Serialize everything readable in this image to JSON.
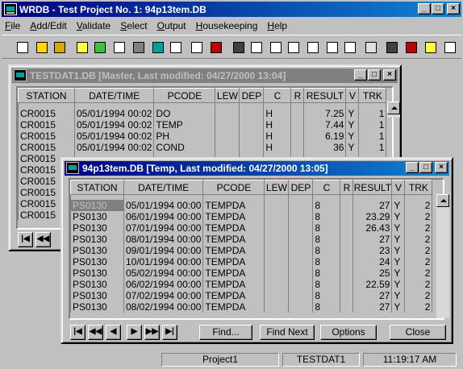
{
  "app": {
    "title": "WRDB - Test Project No. 1: 94p13tem.DB",
    "menu": [
      "File",
      "Add/Edit",
      "Validate",
      "Select",
      "Output",
      "Housekeeping",
      "Help"
    ],
    "window_buttons": {
      "minimize": "_",
      "maximize": "□",
      "close": "×"
    }
  },
  "toolbar_icons": [
    "new-icon",
    "open-icon",
    "open-folder-icon",
    "folder-yellow-icon",
    "folder-green-icon",
    "print-preview-icon",
    "print-icon",
    "calculator-icon",
    "table-icon",
    "stack-icon",
    "db-icon",
    "binoculars-icon",
    "search-doc-icon",
    "grid-icon",
    "copy-icon",
    "spreadsheet-icon",
    "line-chart-icon",
    "line-chart-red-icon",
    "database-icon",
    "save-icon",
    "delete-icon",
    "import-icon",
    "draw-icon"
  ],
  "status": {
    "project": "Project1",
    "table": "TESTDAT1",
    "time": "11:19:17 AM"
  },
  "back_window": {
    "title": "TESTDAT1.DB  [Master,  Last modified: 04/27/2000 13:04]",
    "columns": [
      "STATION",
      "DATE/TIME",
      "PCODE",
      "LEW",
      "DEP",
      "C",
      "R",
      "RESULT",
      "V",
      "TRK"
    ],
    "rows": [
      [
        "CR0015",
        "05/01/1994 00:02",
        "DO",
        "",
        "",
        "H",
        "",
        "7.25",
        "Y",
        "1"
      ],
      [
        "CR0015",
        "05/01/1994 00:02",
        "TEMP",
        "",
        "",
        "H",
        "",
        "7.44",
        "Y",
        "1"
      ],
      [
        "CR0015",
        "05/01/1994 00:02",
        "PH",
        "",
        "",
        "H",
        "",
        "6.19",
        "Y",
        "1"
      ],
      [
        "CR0015",
        "05/01/1994 00:02",
        "COND",
        "",
        "",
        "H",
        "",
        "36",
        "Y",
        "1"
      ],
      [
        "CR0015",
        "",
        "",
        "",
        "",
        "",
        "",
        "",
        "",
        ""
      ],
      [
        "CR0015",
        "",
        "",
        "",
        "",
        "",
        "",
        "",
        "",
        ""
      ],
      [
        "CR0015",
        "",
        "",
        "",
        "",
        "",
        "",
        "",
        "",
        ""
      ],
      [
        "CR0015",
        "",
        "",
        "",
        "",
        "",
        "",
        "",
        "",
        ""
      ],
      [
        "CR0015",
        "",
        "",
        "",
        "",
        "",
        "",
        "",
        "",
        ""
      ],
      [
        "CR0015",
        "",
        "",
        "",
        "",
        "",
        "",
        "",
        "",
        ""
      ]
    ]
  },
  "front_window": {
    "title": "94p13tem.DB  [Temp,  Last modified: 04/27/2000 13:05]",
    "columns": [
      "STATION",
      "DATE/TIME",
      "PCODE",
      "LEW",
      "DEP",
      "C",
      "R",
      "RESULT",
      "V",
      "TRK"
    ],
    "rows": [
      [
        "PS0130",
        "05/01/1994 00:00",
        "TEMPDA",
        "",
        "",
        "8",
        "",
        "27",
        "Y",
        "2"
      ],
      [
        "PS0130",
        "06/01/1994 00:00",
        "TEMPDA",
        "",
        "",
        "8",
        "",
        "23.29",
        "Y",
        "2"
      ],
      [
        "PS0130",
        "07/01/1994 00:00",
        "TEMPDA",
        "",
        "",
        "8",
        "",
        "26.43",
        "Y",
        "2"
      ],
      [
        "PS0130",
        "08/01/1994 00:00",
        "TEMPDA",
        "",
        "",
        "8",
        "",
        "27",
        "Y",
        "2"
      ],
      [
        "PS0130",
        "09/01/1994 00:00",
        "TEMPDA",
        "",
        "",
        "8",
        "",
        "23",
        "Y",
        "2"
      ],
      [
        "PS0130",
        "10/01/1994 00:00",
        "TEMPDA",
        "",
        "",
        "8",
        "",
        "24",
        "Y",
        "2"
      ],
      [
        "PS0130",
        "05/02/1994 00:00",
        "TEMPDA",
        "",
        "",
        "8",
        "",
        "25",
        "Y",
        "2"
      ],
      [
        "PS0130",
        "06/02/1994 00:00",
        "TEMPDA",
        "",
        "",
        "8",
        "",
        "22.59",
        "Y",
        "2"
      ],
      [
        "PS0130",
        "07/02/1994 00:00",
        "TEMPDA",
        "",
        "",
        "8",
        "",
        "27",
        "Y",
        "2"
      ],
      [
        "PS0130",
        "08/02/1994 00:00",
        "TEMPDA",
        "",
        "",
        "8",
        "",
        "27",
        "Y",
        "2"
      ]
    ],
    "nav": [
      "|◀",
      "◀◀",
      "◀",
      "▶",
      "▶▶",
      "▶|"
    ],
    "buttons": {
      "find": "Find...",
      "find_next": "Find Next",
      "options": "Options",
      "close": "Close"
    }
  }
}
